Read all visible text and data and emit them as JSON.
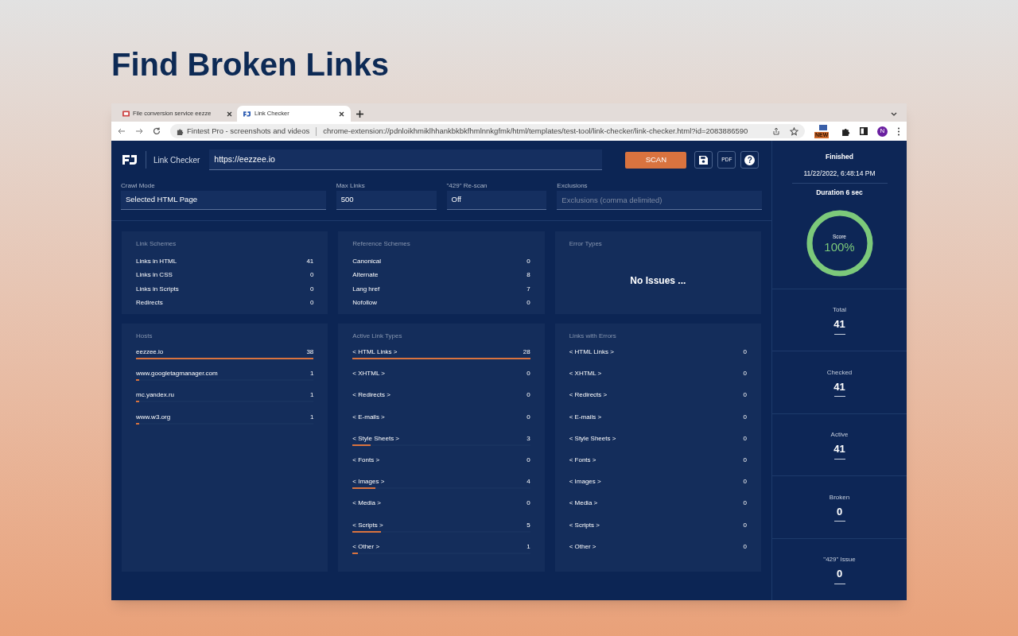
{
  "headline": "Find Broken Links",
  "browser": {
    "tabs": [
      {
        "title": "File conversion service eezze",
        "selected": false
      },
      {
        "title": "Link Checker",
        "selected": true
      }
    ],
    "site_label": "Fintest Pro - screenshots and videos",
    "url": "chrome-extension://pdnloikhmiklhhankbkbkfhmlnnkgfmk/html/templates/test-tool/link-checker/link-checker.html?id=2083886590",
    "extension_badge": "NEW",
    "profile_initial": "N"
  },
  "app": {
    "title": "Link Checker",
    "url_value": "https://eezzee.io",
    "scan_button": "SCAN",
    "pdf_button": "PDF",
    "help_button": "?",
    "fields": [
      {
        "label": "Crawl Mode",
        "value": "Selected HTML Page"
      },
      {
        "label": "Max Links",
        "value": "500"
      },
      {
        "label": "\"429\" Re-scan",
        "value": "Off"
      },
      {
        "label": "Exclusions",
        "placeholder": "Exclusions (comma delimited)"
      }
    ],
    "summary_cards": [
      {
        "title": "Link Schemes",
        "rows": [
          {
            "label": "Links in HTML",
            "count": "41"
          },
          {
            "label": "Links in CSS",
            "count": "0"
          },
          {
            "label": "Links in Scripts",
            "count": "0"
          },
          {
            "label": "Redirects",
            "count": "0"
          }
        ]
      },
      {
        "title": "Reference Schemes",
        "rows": [
          {
            "label": "Canonical",
            "count": "0"
          },
          {
            "label": "Alternate",
            "count": "8"
          },
          {
            "label": "Lang href",
            "count": "7"
          },
          {
            "label": "Nofollow",
            "count": "0"
          }
        ]
      },
      {
        "title": "Error Types",
        "message": "No Issues ..."
      }
    ],
    "detail_cards": [
      {
        "title": "Hosts",
        "rows": [
          {
            "label": "eezzee.io",
            "count": "38",
            "level": 1
          },
          {
            "label": "www.googletagmanager.com",
            "count": "1",
            "level": 0.02
          },
          {
            "label": "mc.yandex.ru",
            "count": "1",
            "level": 0.02
          },
          {
            "label": "www.w3.org",
            "count": "1",
            "level": 0.02
          }
        ]
      },
      {
        "title": "Active Link Types",
        "rows": [
          {
            "label": "< HTML Links >",
            "count": "28",
            "level": 1
          },
          {
            "label": "< XHTML >",
            "count": "0"
          },
          {
            "label": "< Redirects >",
            "count": "0"
          },
          {
            "label": "< E-mails >",
            "count": "0"
          },
          {
            "label": "< Style Sheets >",
            "count": "3",
            "level": 0.1
          },
          {
            "label": "< Fonts >",
            "count": "0"
          },
          {
            "label": "< Images >",
            "count": "4",
            "level": 0.13
          },
          {
            "label": "< Media >",
            "count": "0"
          },
          {
            "label": "< Scripts >",
            "count": "5",
            "level": 0.16
          },
          {
            "label": "< Other >",
            "count": "1",
            "level": 0.03
          }
        ]
      },
      {
        "title": "Links with Errors",
        "rows": [
          {
            "label": "< HTML Links >",
            "count": "0"
          },
          {
            "label": "< XHTML >",
            "count": "0"
          },
          {
            "label": "< Redirects >",
            "count": "0"
          },
          {
            "label": "< E-mails >",
            "count": "0"
          },
          {
            "label": "< Style Sheets >",
            "count": "0"
          },
          {
            "label": "< Fonts >",
            "count": "0"
          },
          {
            "label": "< Images >",
            "count": "0"
          },
          {
            "label": "< Media >",
            "count": "0"
          },
          {
            "label": "< Scripts >",
            "count": "0"
          },
          {
            "label": "< Other >",
            "count": "0"
          }
        ]
      }
    ]
  },
  "status": {
    "state": "Finished",
    "date": "11/22/2022, 6:48:14 PM",
    "duration": "Duration 6 sec",
    "score_label": "Score",
    "score": "100%",
    "level": 1,
    "stats": [
      {
        "label": "Total",
        "value": "41"
      },
      {
        "label": "Checked",
        "value": "41"
      },
      {
        "label": "Active",
        "value": "41"
      },
      {
        "label": "Broken",
        "value": "0"
      },
      {
        "label": "\"429\" Issue",
        "value": "0"
      }
    ]
  }
}
